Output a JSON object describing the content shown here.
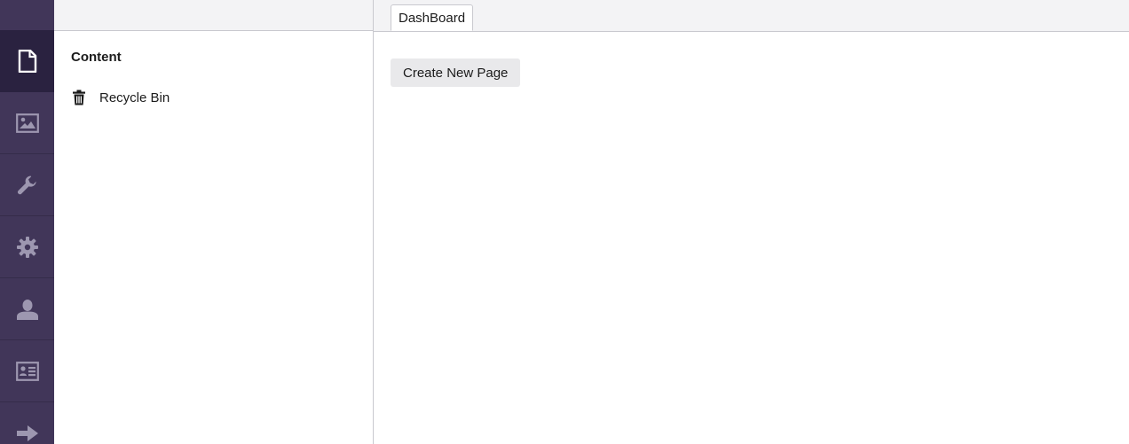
{
  "rail": {
    "items": [
      {
        "icon": "document-icon",
        "active": true
      },
      {
        "icon": "image-icon",
        "active": false
      },
      {
        "icon": "wrench-icon",
        "active": false
      },
      {
        "icon": "gear-icon",
        "active": false
      },
      {
        "icon": "user-icon",
        "active": false
      },
      {
        "icon": "id-card-icon",
        "active": false
      },
      {
        "icon": "arrow-right-icon",
        "active": false
      }
    ]
  },
  "tree": {
    "heading": "Content",
    "items": [
      {
        "label": "Recycle Bin",
        "icon": "trash-icon"
      }
    ]
  },
  "main": {
    "tabs": [
      {
        "label": "DashBoard"
      }
    ],
    "create_button_label": "Create New Page"
  },
  "colors": {
    "rail_bg": "#413659",
    "rail_active_bg": "#2a2240",
    "rail_icon": "#9d97b0",
    "header_bg": "#f3f3f5",
    "button_bg": "#e9e9eb"
  }
}
